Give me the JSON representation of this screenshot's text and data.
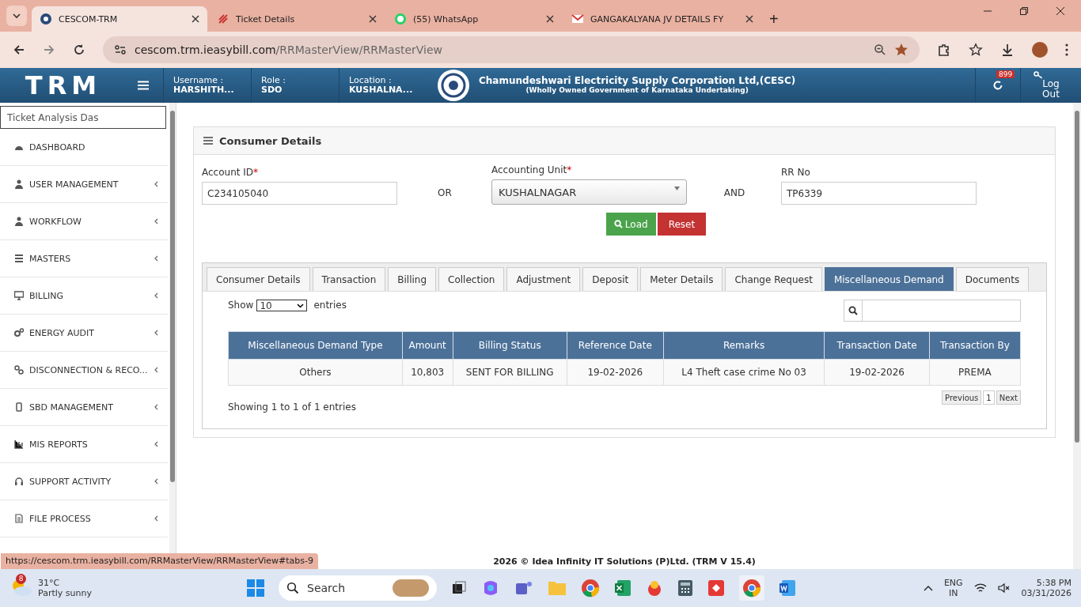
{
  "browser": {
    "tabs": [
      {
        "title": "CESCOM-TRM",
        "selected": true
      },
      {
        "title": "Ticket Details",
        "selected": false
      },
      {
        "title": "(55) WhatsApp",
        "selected": false
      },
      {
        "title": "GANGAKALYANA JV DETAILS FY",
        "selected": false
      }
    ],
    "new_tab": "+",
    "address_host": "cescom.trm.ieasybill.com",
    "address_path": "/RRMasterView/RRMasterView"
  },
  "header": {
    "logo": "TRM",
    "fields": [
      {
        "label": "Username :",
        "value": "HARSHITH..."
      },
      {
        "label": "Role :",
        "value": "SDO"
      },
      {
        "label": "Location :",
        "value": "KUSHALNA..."
      }
    ],
    "org_title": "Chamundeshwari Electricity Supply Corporation Ltd,(CESC)",
    "org_subtitle": "(Wholly Owned Government of Karnataka Undertaking)",
    "notification_count": "899",
    "logout": "Log Out"
  },
  "sidebar": {
    "search_value": "Ticket Analysis Das",
    "items": [
      {
        "label": "DASHBOARD",
        "expandable": false
      },
      {
        "label": "USER MANAGEMENT",
        "expandable": true
      },
      {
        "label": "WORKFLOW",
        "expandable": true
      },
      {
        "label": "MASTERS",
        "expandable": true
      },
      {
        "label": "BILLING",
        "expandable": true
      },
      {
        "label": "ENERGY AUDIT",
        "expandable": true
      },
      {
        "label": "DISCONNECTION & RECO...",
        "expandable": true
      },
      {
        "label": "SBD MANAGEMENT",
        "expandable": true
      },
      {
        "label": "MIS REPORTS",
        "expandable": true
      },
      {
        "label": "SUPPORT ACTIVITY",
        "expandable": true
      },
      {
        "label": "FILE PROCESS",
        "expandable": true
      }
    ]
  },
  "panel": {
    "title": "Consumer Details",
    "required_mark": "*",
    "fields": [
      {
        "kind": "input",
        "label": "Account ID",
        "required": true,
        "value": "C234105040"
      },
      {
        "kind": "joiner",
        "label": "OR"
      },
      {
        "kind": "select",
        "label": "Accounting Unit",
        "required": true,
        "value": "KUSHALNAGAR"
      },
      {
        "kind": "joiner",
        "label": "AND"
      },
      {
        "kind": "input",
        "label": "RR No",
        "required": false,
        "value": "TP6339"
      }
    ],
    "buttons": [
      {
        "kind": "load",
        "label": "Load"
      },
      {
        "kind": "reset",
        "label": "Reset"
      }
    ],
    "tabs": [
      {
        "label": "Consumer Details",
        "selected": false
      },
      {
        "label": "Transaction",
        "selected": false
      },
      {
        "label": "Billing",
        "selected": false
      },
      {
        "label": "Collection",
        "selected": false
      },
      {
        "label": "Adjustment",
        "selected": false
      },
      {
        "label": "Deposit",
        "selected": false
      },
      {
        "label": "Meter Details",
        "selected": false
      },
      {
        "label": "Change Request",
        "selected": false
      },
      {
        "label": "Miscellaneous Demand",
        "selected": true
      },
      {
        "label": "Documents",
        "selected": false
      }
    ],
    "table": {
      "show_label": "Show",
      "page_size": "10",
      "entries_label": "entries",
      "columns": [
        "Miscellaneous Demand Type",
        "Amount",
        "Billing Status",
        "Reference Date",
        "Remarks",
        "Transaction Date",
        "Transaction By"
      ],
      "rows": [
        [
          "Others",
          "10,803",
          "SENT FOR BILLING",
          "19-02-2026",
          "L4 Theft case crime No 03",
          "19-02-2026",
          "PREMA"
        ]
      ],
      "info": "Showing 1 to 1 of 1 entries",
      "pagination": [
        {
          "label": "Previous",
          "selected": false
        },
        {
          "label": "1",
          "selected": true
        },
        {
          "label": "Next",
          "selected": false
        }
      ]
    }
  },
  "footer": "2026 © Idea Infinity IT Solutions (P)Ltd. (TRM V 15.4)",
  "status_url": "https://cescom.trm.ieasybill.com/RRMasterView/RRMasterView#tabs-9",
  "taskbar": {
    "weather_badge": "8",
    "temperature": "31°C",
    "weather": "Partly sunny",
    "search": "Search",
    "lang": "ENG",
    "region": "IN",
    "time": "5:38 PM",
    "date": "03/31/2026"
  }
}
